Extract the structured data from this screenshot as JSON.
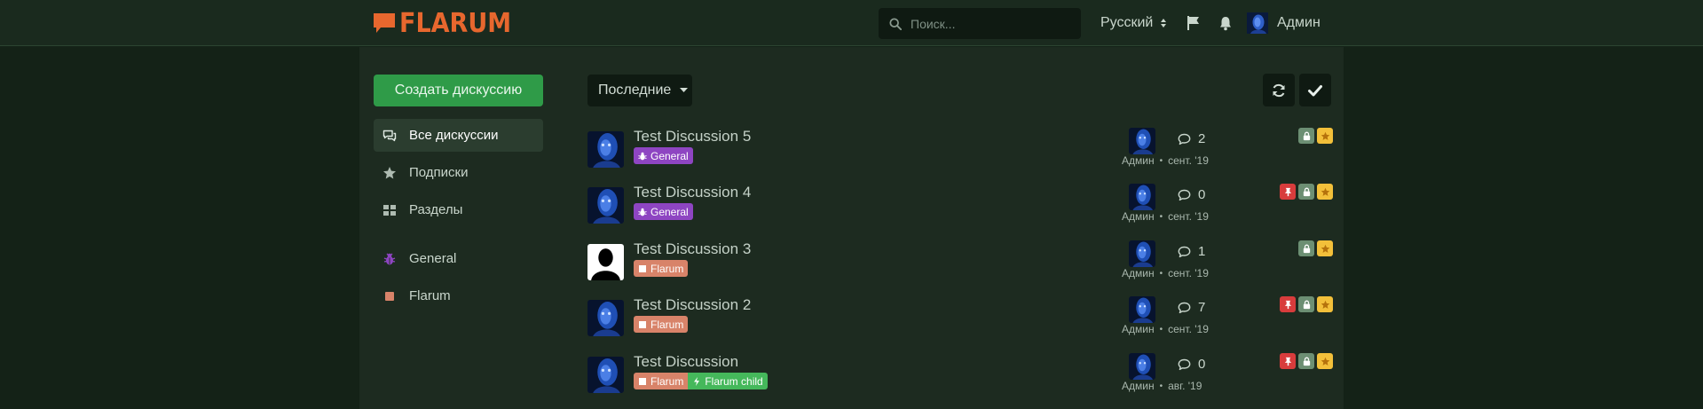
{
  "header": {
    "logo_text": "FLARUM",
    "search_placeholder": "Поиск...",
    "language": "Русский",
    "user_name": "Админ"
  },
  "sidebar": {
    "create_label": "Создать дискуссию",
    "items": [
      {
        "label": "Все дискуссии",
        "icon": "comments-icon",
        "active": true
      },
      {
        "label": "Подписки",
        "icon": "star-icon"
      },
      {
        "label": "Разделы",
        "icon": "grid-icon"
      }
    ],
    "tags": [
      {
        "label": "General",
        "icon": "bug-icon",
        "color": "#8e45c2"
      },
      {
        "label": "Flarum",
        "icon": "square-icon",
        "color": "#d88369"
      }
    ]
  },
  "toolbar": {
    "sort_label": "Последние"
  },
  "colors": {
    "general": "#8e45c2",
    "flarum": "#d88369",
    "flarum_child": "#45b85b",
    "badge_sticky": "#d83c3c",
    "badge_locked": "#6c8f73",
    "badge_star": "#f3c03a"
  },
  "discussions": [
    {
      "title": "Test Discussion 5",
      "tags": [
        {
          "label": "General",
          "color": "#8e45c2",
          "icon": "bug-icon"
        }
      ],
      "author_avatar": "avatar-blue",
      "replies": "2",
      "user": "Админ",
      "date": "сент. '19",
      "badges": [
        "lock-icon",
        "star-icon"
      ]
    },
    {
      "title": "Test Discussion 4",
      "tags": [
        {
          "label": "General",
          "color": "#8e45c2",
          "icon": "bug-icon"
        }
      ],
      "author_avatar": "avatar-blue",
      "replies": "0",
      "user": "Админ",
      "date": "сент. '19",
      "badges": [
        "thumbtack-icon",
        "lock-icon",
        "star-icon"
      ]
    },
    {
      "title": "Test Discussion 3",
      "tags": [
        {
          "label": "Flarum",
          "color": "#d88369",
          "icon": "square-icon"
        }
      ],
      "author_avatar": "avatar-default",
      "replies": "1",
      "user": "Админ",
      "date": "сент. '19",
      "badges": [
        "lock-icon",
        "star-icon"
      ]
    },
    {
      "title": "Test Discussion 2",
      "tags": [
        {
          "label": "Flarum",
          "color": "#d88369",
          "icon": "square-icon"
        }
      ],
      "author_avatar": "avatar-blue",
      "replies": "7",
      "user": "Админ",
      "date": "сент. '19",
      "badges": [
        "thumbtack-icon",
        "lock-icon",
        "star-icon"
      ]
    },
    {
      "title": "Test Discussion",
      "tags": [
        {
          "label": "Flarum",
          "color": "#d88369",
          "icon": "square-icon"
        },
        {
          "label": "Flarum child",
          "color": "#45b85b",
          "icon": "bolt-icon"
        }
      ],
      "author_avatar": "avatar-blue",
      "replies": "0",
      "user": "Админ",
      "date": "авг. '19",
      "badges": [
        "thumbtack-icon",
        "lock-icon",
        "star-icon"
      ]
    }
  ]
}
